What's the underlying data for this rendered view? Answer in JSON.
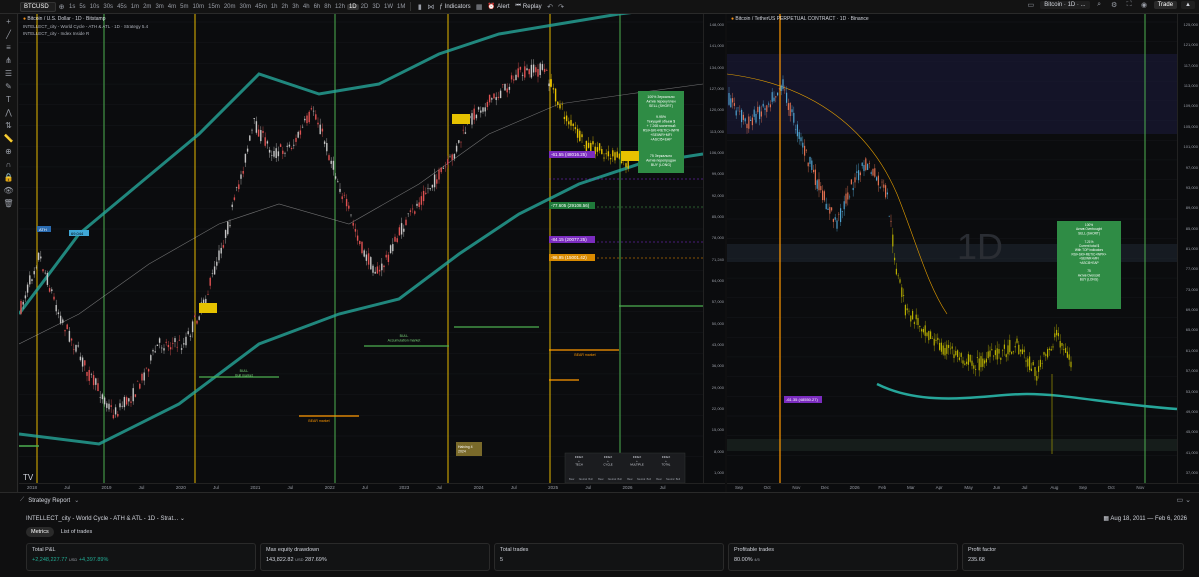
{
  "toolbar": {
    "symbol": "BTCUSD",
    "timeframes": [
      "1s",
      "5s",
      "10s",
      "30s",
      "45s",
      "1m",
      "2m",
      "3m",
      "4m",
      "5m",
      "10m",
      "15m",
      "20m",
      "30m",
      "45m",
      "1h",
      "2h",
      "3h",
      "4h",
      "6h",
      "8h",
      "12h",
      "1D",
      "2D",
      "3D",
      "1W",
      "1M"
    ],
    "active_timeframe": "1D",
    "indicators_label": "Indicators",
    "alert_label": "Alert",
    "replay_label": "Replay",
    "right_symbol": "Bitcoin · 1D · ...",
    "trade_label": "Trade"
  },
  "left_pane": {
    "title": "Bitcoin / U.S. Dollar · 1D · Bitstamp",
    "indicator_1": "INTELLECT_city - World Cycle - ATH & ATL · 1D · Strategy 5.4",
    "indicator_2": "INTELLECT_city - Index Inside R",
    "currency": "USD",
    "price_labels": [
      "148,000",
      "141,000",
      "134,000",
      "127,000",
      "120,000",
      "113,000",
      "106,000",
      "99,000",
      "92,000",
      "85,000",
      "78,000",
      "71,240",
      "64,000",
      "57,000",
      "50,000",
      "43,000",
      "36,000",
      "29,000",
      "22,000",
      "15,000",
      "8,000",
      "1,000"
    ],
    "time_labels": [
      "2018",
      "Jul",
      "2019",
      "Jul",
      "2020",
      "Jul",
      "2021",
      "Jul",
      "2022",
      "Jul",
      "2023",
      "Jul",
      "2024",
      "Jul",
      "2025",
      "Jul",
      "2026",
      "Jul"
    ],
    "end_date_badge": "Tue 03 Nov '26",
    "annotations": {
      "box_sell": "100% Зеркально\nАктив перекуплен\nSELL (SHORT)",
      "box_mid": "9.95%\nТекущий объем $\n+ 7.265 монетный\nRSI+SKI+RETIC+WPR\n+SEIWR+MFI\n+ASCI5+EAP",
      "box_buy": "75 Зеркально\nАктив перепродан\nBUY (LONG)",
      "level_violet_1": "-61.55 (48016.25)",
      "level_green": "-77.605 (29108.56)",
      "level_violet_2": "-84.15 (20077.25)",
      "level_orange": "-96.95 (15001.42)",
      "halving": "Halving 4\n2024",
      "bull_1": "BULL\nBull market",
      "bull_2": "BULL\nAccumulation market",
      "bear_1": "BEAR market",
      "bear_2": "BEAR market",
      "ath_label": "ATH",
      "ath_price": "69,044"
    },
    "legend_headers": [
      "INDEX\n+\nTECH",
      "INDEX\n+\nCYCLE",
      "INDEX\n+\nMULTIPLE",
      "INDEX\n+\nTOTAL"
    ],
    "legend_subs": [
      "Bear",
      "Neutral",
      "Bull",
      "Bear",
      "Neutral",
      "Bull",
      "Bear",
      "Neutral",
      "Bull",
      "Bear",
      "Neutral",
      "Bull"
    ]
  },
  "right_pane": {
    "title": "Bitcoin / TetherUS PERPETUAL CONTRACT · 1D · Binance",
    "watermark": "1D",
    "price_labels": [
      "125,000",
      "121,000",
      "117,000",
      "113,000",
      "109,000",
      "105,000",
      "101,000",
      "97,000",
      "93,000",
      "89,000",
      "85,000",
      "81,000",
      "77,000",
      "73,000",
      "69,000",
      "65,000",
      "61,000",
      "57,000",
      "53,000",
      "49,000",
      "45,000",
      "41,000",
      "37,000"
    ],
    "current_price": "71,256.3",
    "time_labels": [
      "Sep",
      "Oct",
      "Nov",
      "Dec",
      "2026",
      "Feb",
      "Mar",
      "Apr",
      "May",
      "Jun",
      "Jul",
      "Aug",
      "Sep",
      "Oct",
      "Nov"
    ],
    "end_date_badge": "Tue 03 Nov '26",
    "box_text": "100%\nАктив Overbought\nSELL (SHORT)\n\n7.21%\nCurrent total $\nWith TOP indicators\nRSI+SKI+RETIC+WPR+\n+SEIWR+MFI\n+ASCI5+EAP\n\n75\nАктив Oversold\nBUY (LONG)",
    "level_label": "-61.35 (48550.27)"
  },
  "report": {
    "title": "Strategy Report",
    "strategy_name": "INTELLECT_city - World Cycle - ATH & ATL - 1D - Strat...",
    "date_range": "Aug 18, 2011 — Feb 6, 2026",
    "tabs": [
      "Metrics",
      "List of trades"
    ],
    "active_tab": "Metrics",
    "metrics": [
      {
        "label": "Total P&L",
        "value": "+2,248,227.77",
        "unit": "USD",
        "extra": "+4,397.89%"
      },
      {
        "label": "Max equity drawdown",
        "value": "143,822.82",
        "unit": "USD",
        "extra": "287.69%"
      },
      {
        "label": "Total trades",
        "value": "5",
        "unit": "",
        "extra": ""
      },
      {
        "label": "Profitable trades",
        "value": "80.00%",
        "unit": "",
        "extra": "4/5"
      },
      {
        "label": "Profit factor",
        "value": "235.68",
        "unit": "",
        "extra": ""
      }
    ]
  },
  "colors": {
    "yellow_line": "#e6b800",
    "green_line": "#4caf50",
    "orange_line": "#ff9800",
    "channel": "#26a69a",
    "candle_up": "#c7c7c7",
    "candle_dn": "#e05252",
    "positive": "#22ab94"
  }
}
